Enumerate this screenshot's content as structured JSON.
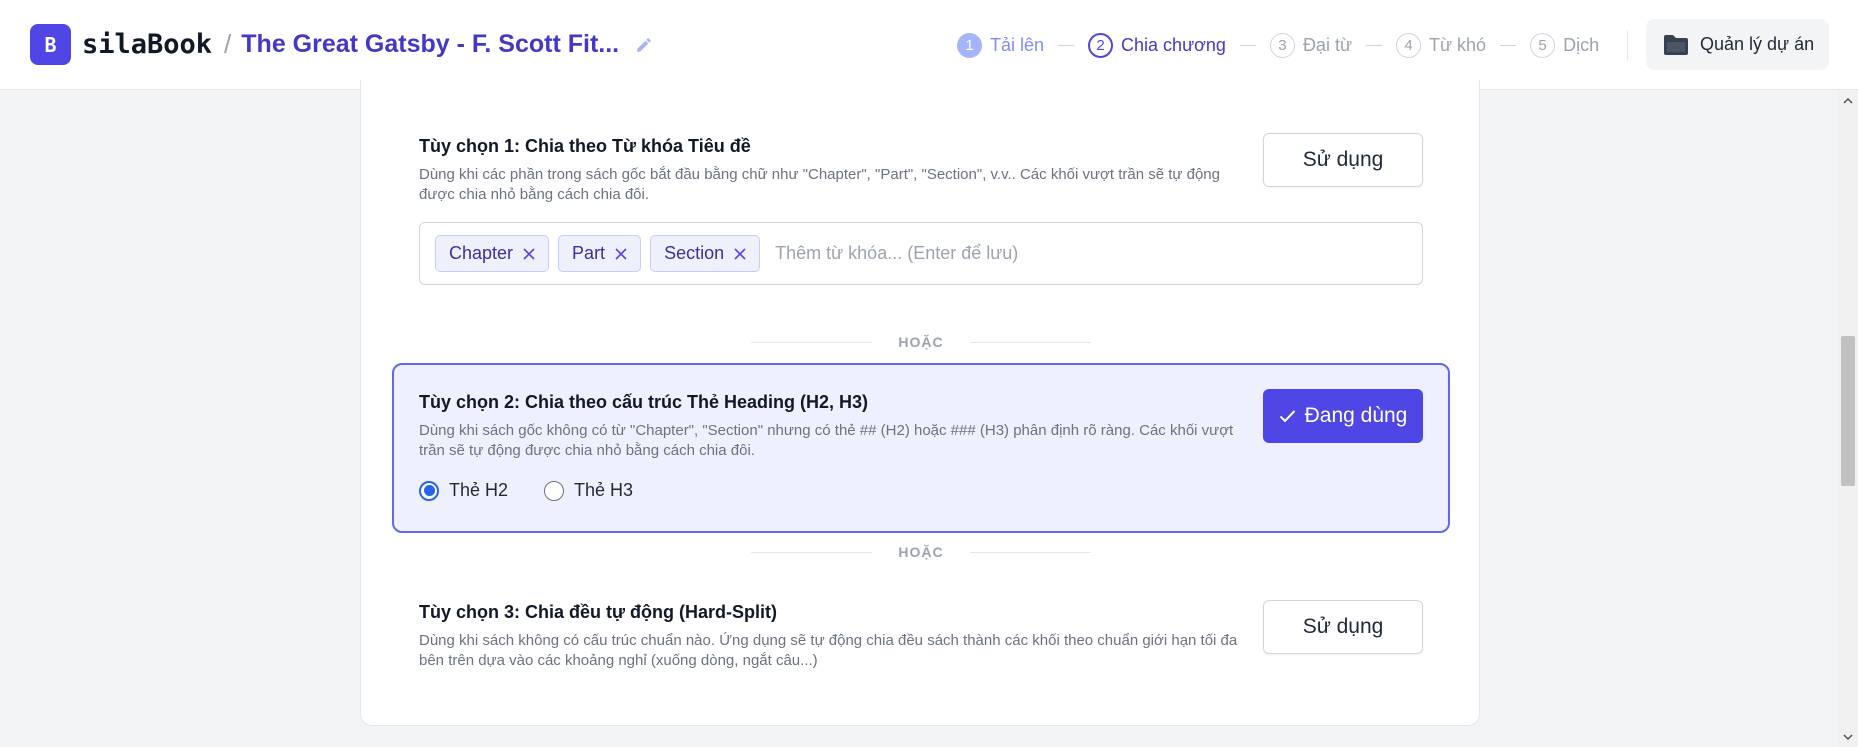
{
  "header": {
    "logo_letter": "B",
    "brand": "silaBook",
    "separator": "/",
    "project_title": "The Great Gatsby - F. Scott Fit...",
    "steps": [
      {
        "num": "1",
        "label": "Tải lên",
        "state": "done"
      },
      {
        "num": "2",
        "label": "Chia chương",
        "state": "active"
      },
      {
        "num": "3",
        "label": "Đại từ",
        "state": "todo"
      },
      {
        "num": "4",
        "label": "Từ khó",
        "state": "todo"
      },
      {
        "num": "5",
        "label": "Dịch",
        "state": "todo"
      }
    ],
    "manage_label": "Quản lý dự án"
  },
  "options": {
    "opt1": {
      "title": "Tùy chọn 1: Chia theo Từ khóa Tiêu đề",
      "desc": "Dùng khi các phần trong sách gốc bắt đầu bằng chữ như \"Chapter\", \"Part\", \"Section\", v.v.. Các khối vượt trần sẽ tự động được chia nhỏ bằng cách chia đôi.",
      "button": "Sử dụng",
      "tags": [
        "Chapter",
        "Part",
        "Section"
      ],
      "input_placeholder": "Thêm từ khóa... (Enter để lưu)"
    },
    "or_label": "HOẶC",
    "opt2": {
      "title": "Tùy chọn 2: Chia theo cấu trúc Thẻ Heading (H2, H3)",
      "desc": "Dùng khi sách gốc không có từ \"Chapter\", \"Section\" nhưng có thẻ ## (H2) hoặc ### (H3) phân định rõ ràng. Các khối vượt trần sẽ tự động được chia nhỏ bằng cách chia đôi.",
      "button": "Đang dùng",
      "radio_h2": "Thẻ H2",
      "radio_h3": "Thẻ H3",
      "selected": "h2"
    },
    "opt3": {
      "title": "Tùy chọn 3: Chia đều tự động (Hard-Split)",
      "desc": "Dùng khi sách không có cấu trúc chuẩn nào. Ứng dụng sẽ tự động chia đều sách thành các khối theo chuẩn giới hạn tối đa bên trên dựa vào các khoảng nghỉ (xuống dòng, ngắt câu...)",
      "button": "Sử dụng"
    }
  },
  "colors": {
    "accent": "#4f46e5",
    "selected_bg": "#eef1fd"
  }
}
